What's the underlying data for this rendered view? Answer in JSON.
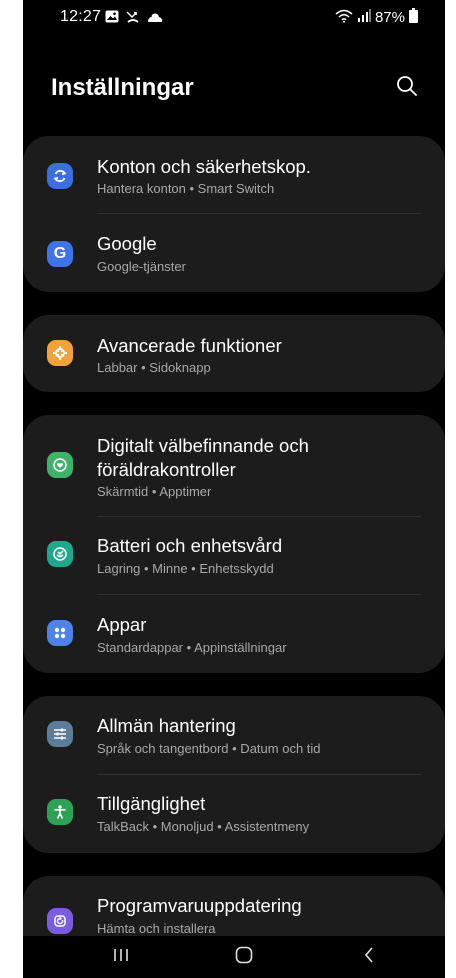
{
  "status_bar": {
    "time": "12:27",
    "battery": "87%",
    "left_icons": [
      "image-icon",
      "missed-call-icon",
      "cloud-icon"
    ],
    "right_icons": [
      "wifi-icon",
      "signal-icon",
      "battery-icon"
    ]
  },
  "header": {
    "title": "Inställningar",
    "search_icon": "search-icon"
  },
  "groups": [
    {
      "items": [
        {
          "title": "Konton och säkerhetskop.",
          "subtitle": "Hantera konton  •  Smart Switch",
          "icon": "sync-icon",
          "color": "#3d6ee0"
        },
        {
          "title": "Google",
          "subtitle": "Google-tjänster",
          "icon": "google-icon",
          "color": "#3f74e8"
        }
      ]
    },
    {
      "items": [
        {
          "title": "Avancerade funktioner",
          "subtitle": "Labbar  •  Sidoknapp",
          "icon": "gear-plus-icon",
          "color": "#f2a33b"
        }
      ]
    },
    {
      "items": [
        {
          "title": "Digitalt välbefinnande och",
          "title2": "föräldrakontroller",
          "subtitle": "Skärmtid  •  Apptimer",
          "icon": "wellbeing-icon",
          "color": "#3fb26a"
        },
        {
          "title": "Batteri och enhetsvård",
          "subtitle": "Lagring  •  Minne  •  Enhetsskydd",
          "icon": "device-care-icon",
          "color": "#1fa98c"
        },
        {
          "title": "Appar",
          "subtitle": "Standardappar  •  Appinställningar",
          "icon": "apps-icon",
          "color": "#4f82e6"
        }
      ]
    },
    {
      "items": [
        {
          "title": "Allmän hantering",
          "subtitle": "Språk och tangentbord  •  Datum och tid",
          "icon": "sliders-icon",
          "color": "#5d7d99"
        },
        {
          "title": "Tillgänglighet",
          "subtitle": "TalkBack  •  Monoljud  •  Assistentmeny",
          "icon": "accessibility-icon",
          "color": "#2fa157"
        }
      ]
    },
    {
      "items": [
        {
          "title": "Programvaruuppdatering",
          "subtitle": "Hämta och installera",
          "icon": "update-icon",
          "color": "#7b5ee0"
        }
      ]
    }
  ],
  "nav_bar": {
    "recents_icon": "recents-icon",
    "home_icon": "home-icon",
    "back_icon": "back-icon"
  }
}
